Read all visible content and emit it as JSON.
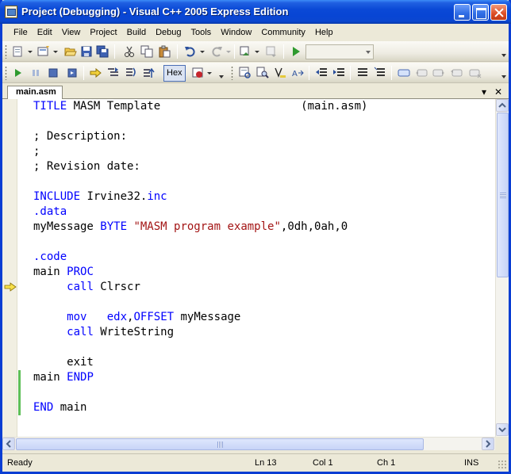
{
  "window": {
    "title": "Project (Debugging) - Visual C++ 2005 Express Edition"
  },
  "menu": [
    "File",
    "Edit",
    "View",
    "Project",
    "Build",
    "Debug",
    "Tools",
    "Window",
    "Community",
    "Help"
  ],
  "toolbar": {
    "hex_label": "Hex"
  },
  "document_tab": {
    "label": "main.asm",
    "dropdown_icon": "chevron-down-icon",
    "close_icon": "close-icon"
  },
  "editor": {
    "lines": [
      [
        {
          "t": "TITLE",
          "c": "kw"
        },
        {
          "t": " MASM Template                     (main.asm)",
          "c": "plain"
        }
      ],
      [],
      [
        {
          "t": "; Description:",
          "c": "plain"
        }
      ],
      [
        {
          "t": ";",
          "c": "plain"
        }
      ],
      [
        {
          "t": "; Revision date:",
          "c": "plain"
        }
      ],
      [],
      [
        {
          "t": "INCLUDE",
          "c": "kw"
        },
        {
          "t": " Irvine32.",
          "c": "plain"
        },
        {
          "t": "inc",
          "c": "kw"
        }
      ],
      [
        {
          "t": ".data",
          "c": "kw"
        }
      ],
      [
        {
          "t": "myMessage ",
          "c": "plain"
        },
        {
          "t": "BYTE",
          "c": "kw"
        },
        {
          "t": " ",
          "c": "plain"
        },
        {
          "t": "\"MASM program example\"",
          "c": "str"
        },
        {
          "t": ",0dh,0ah,0",
          "c": "plain"
        }
      ],
      [],
      [
        {
          "t": ".code",
          "c": "kw"
        }
      ],
      [
        {
          "t": "main ",
          "c": "plain"
        },
        {
          "t": "PROC",
          "c": "kw"
        }
      ],
      [
        {
          "t": "     ",
          "c": "plain"
        },
        {
          "t": "call",
          "c": "kw"
        },
        {
          "t": " Clrscr",
          "c": "plain"
        }
      ],
      [],
      [
        {
          "t": "     ",
          "c": "plain"
        },
        {
          "t": "mov",
          "c": "kw"
        },
        {
          "t": "   ",
          "c": "plain"
        },
        {
          "t": "edx",
          "c": "kw"
        },
        {
          "t": ",",
          "c": "plain"
        },
        {
          "t": "OFFSET",
          "c": "kw"
        },
        {
          "t": " myMessage",
          "c": "plain"
        }
      ],
      [
        {
          "t": "     ",
          "c": "plain"
        },
        {
          "t": "call",
          "c": "kw"
        },
        {
          "t": " WriteString",
          "c": "plain"
        }
      ],
      [],
      [
        {
          "t": "     exit",
          "c": "plain"
        }
      ],
      [
        {
          "t": "main ",
          "c": "plain"
        },
        {
          "t": "ENDP",
          "c": "kw"
        }
      ],
      [],
      [
        {
          "t": "END",
          "c": "kw"
        },
        {
          "t": " main",
          "c": "plain"
        }
      ]
    ],
    "current_line_index": 12
  },
  "status": {
    "text": "Ready",
    "line": "Ln 13",
    "col": "Col 1",
    "ch": "Ch 1",
    "mode": "INS"
  }
}
